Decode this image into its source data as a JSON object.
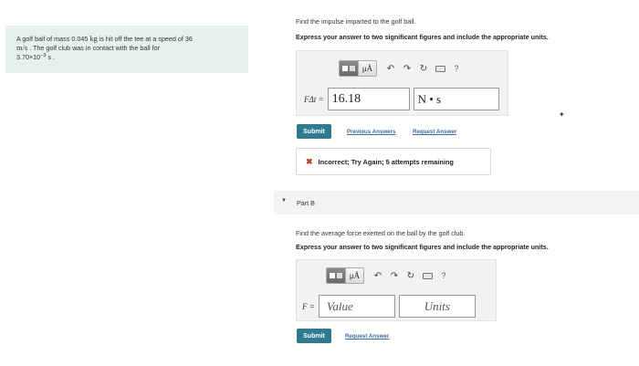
{
  "problem": {
    "text_1": "A golf ball of mass 0.045 ",
    "unit_kg": "kg",
    "text_2": " is hit off the tee at a speed of 36",
    "unit_ms": "m/s",
    "text_3": " . The golf club was in contact with the ball for",
    "time_mantissa": "3.70×10",
    "time_exp": "−3",
    "unit_s": " s",
    "text_4": " ."
  },
  "part_a": {
    "prompt": "Find the impulse imparted to the golf ball.",
    "instruction": "Express your answer to two significant figures and include the appropriate units.",
    "equation_label": "FΔt =",
    "value": "16.18",
    "units": "N • s",
    "submit_label": "Submit",
    "previous_answers_label": "Previous Answers",
    "request_answer_label": "Request Answer",
    "feedback_icon": "✖",
    "feedback_text": "Incorrect; Try Again; 5 attempts remaining"
  },
  "part_b": {
    "title": "Part B",
    "prompt": "Find the average force exerted on the ball by the golf club.",
    "instruction": "Express your answer to two significant figures and include the appropriate units.",
    "equation_label": "F =",
    "value_placeholder": "Value",
    "units_placeholder": "Units",
    "submit_label": "Submit",
    "request_answer_label": "Request Answer"
  },
  "toolbar": {
    "mu_label": "μÅ",
    "help_label": "?",
    "icons": [
      "templates-icon",
      "units-mu-icon",
      "undo-icon",
      "redo-icon",
      "reset-icon",
      "keyboard-icon",
      "help-icon"
    ]
  },
  "colors": {
    "problem_bg": "#e4f1ef",
    "submit_bg": "#2f7a8e",
    "link": "#3a6ea5",
    "error": "#c0392b"
  }
}
